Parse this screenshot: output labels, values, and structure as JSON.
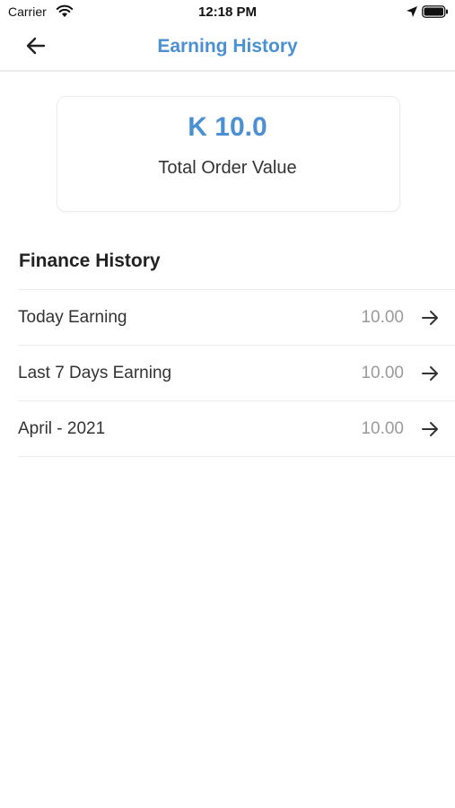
{
  "status_bar": {
    "carrier": "Carrier",
    "time": "12:18 PM",
    "icons": [
      "wifi-icon",
      "location-arrow-icon",
      "battery-icon"
    ]
  },
  "nav": {
    "title": "Earning History",
    "back_icon": "arrow-left-icon"
  },
  "summary": {
    "amount": "K 10.0",
    "label": "Total Order Value"
  },
  "finance_history": {
    "title": "Finance History",
    "rows": [
      {
        "label": "Today Earning",
        "value": "10.00",
        "icon": "arrow-right-icon"
      },
      {
        "label": "Last 7 Days Earning",
        "value": "10.00",
        "icon": "arrow-right-icon"
      },
      {
        "label": "April - 2021",
        "value": "10.00",
        "icon": "arrow-right-icon"
      }
    ]
  },
  "colors": {
    "accent": "#4a90d2",
    "text": "#333333",
    "muted": "#9a9a9a",
    "divider": "#ececec"
  }
}
